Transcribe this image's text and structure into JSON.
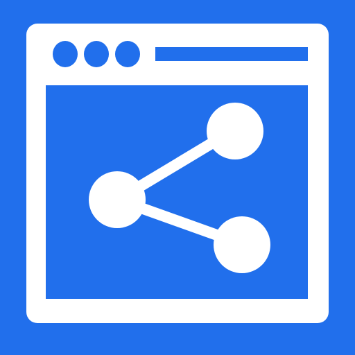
{
  "icon": {
    "name": "browser-window-share-icon",
    "background_color": "#216FEC",
    "foreground_color": "#FFFFFF",
    "window_dots": 3,
    "share_nodes": 3
  }
}
